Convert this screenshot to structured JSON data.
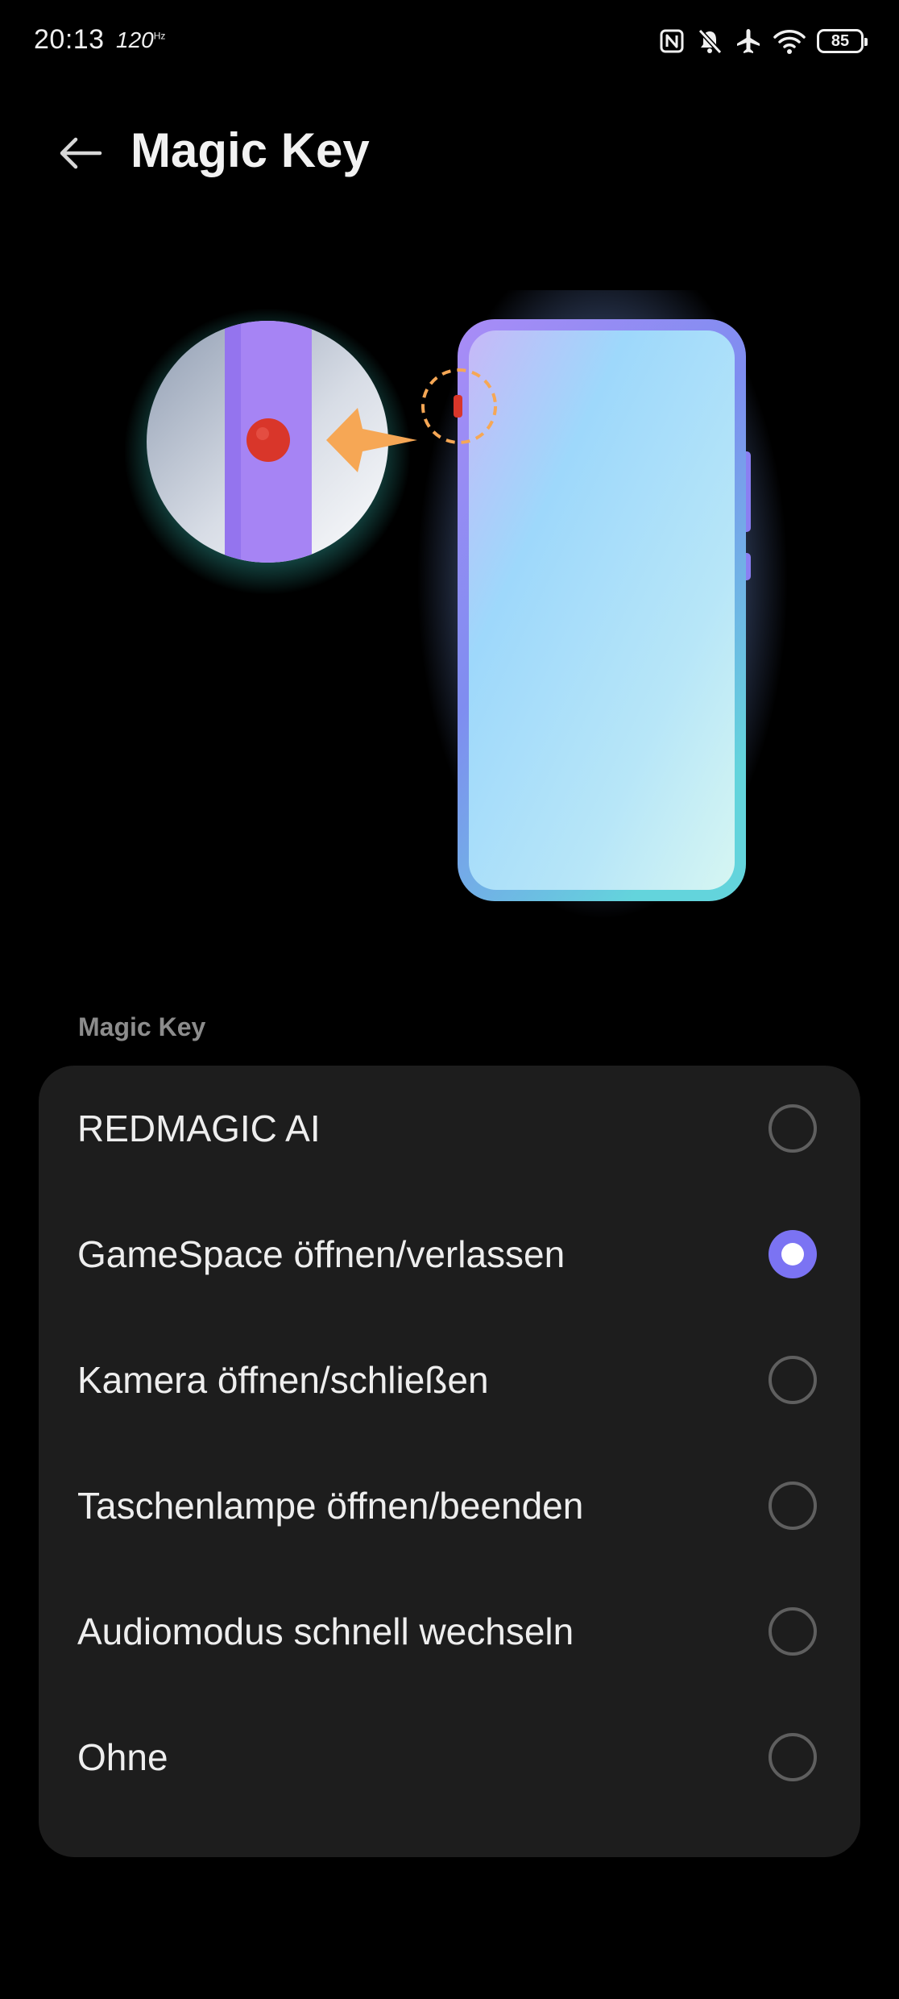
{
  "status_bar": {
    "time": "20:13",
    "refresh_rate": "120",
    "refresh_rate_unit": "Hz",
    "battery_level": "85",
    "icons": [
      "nfc-icon",
      "bell-muted-icon",
      "airplane-icon",
      "wifi-icon",
      "battery-icon"
    ]
  },
  "header": {
    "back_icon": "arrow-left-icon",
    "title": "Magic Key"
  },
  "section": {
    "label": "Magic Key"
  },
  "options": [
    {
      "label": "REDMAGIC AI",
      "selected": false
    },
    {
      "label": "GameSpace öffnen/verlassen",
      "selected": true
    },
    {
      "label": "Kamera öffnen/schließen",
      "selected": false
    },
    {
      "label": "Taschenlampe öffnen/beenden",
      "selected": false
    },
    {
      "label": "Audiomodus schnell wechseln",
      "selected": false
    },
    {
      "label": "Ohne",
      "selected": false
    }
  ],
  "colors": {
    "background": "#000000",
    "card": "#1d1d1d",
    "accent": "#7b73f3",
    "key_highlight": "#d9362a",
    "arrow": "#f6a755"
  }
}
